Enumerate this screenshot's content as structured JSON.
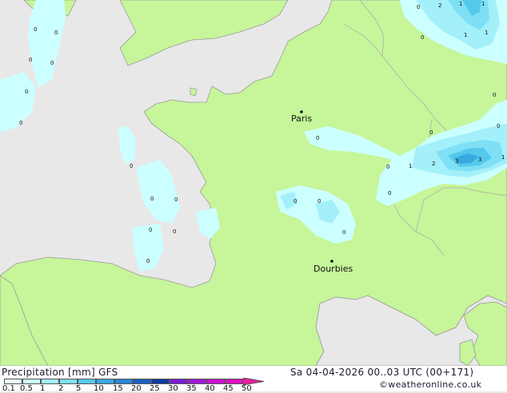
{
  "map": {
    "cities": [
      {
        "name": "Paris"
      },
      {
        "name": "Dourbies"
      }
    ],
    "values": [
      "2",
      "1",
      "1",
      "1",
      "1",
      "0",
      "0",
      "0",
      "0",
      "0",
      "0",
      "0",
      "0",
      "0",
      "0",
      "0",
      "0",
      "0",
      "0",
      "0",
      "0",
      "0",
      "0",
      "0",
      "0",
      "1",
      "2",
      "3",
      "3",
      "1",
      "0",
      "0",
      "0"
    ]
  },
  "footer": {
    "title": "Precipitation [mm] GFS",
    "date": "Sa 04-04-2026 00..03 UTC (00+171)",
    "copyright": "©weatheronline.co.uk",
    "scale_labels": [
      "0.1",
      "0.5",
      "1",
      "2",
      "5",
      "10",
      "15",
      "20",
      "25",
      "30",
      "35",
      "40",
      "45",
      "50"
    ],
    "scale_colors": [
      "#eaffff",
      "#ccffff",
      "#a3f0fa",
      "#7fe0f5",
      "#55c8ec",
      "#3aa8e0",
      "#2a86d2",
      "#1a60c0",
      "#0d3a9e",
      "#7a1bd6",
      "#a018d8",
      "#c814d2",
      "#e010c0",
      "#e81ea0"
    ]
  }
}
